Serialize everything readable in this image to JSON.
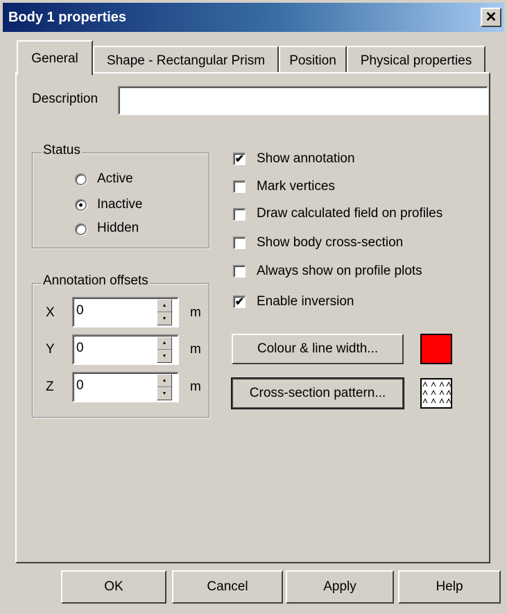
{
  "window": {
    "title": "Body 1 properties",
    "close_glyph": "✕"
  },
  "tabs": [
    {
      "label": "General",
      "active": true
    },
    {
      "label": "Shape - Rectangular Prism",
      "active": false
    },
    {
      "label": "Position",
      "active": false
    },
    {
      "label": "Physical properties",
      "active": false
    }
  ],
  "general": {
    "description_label": "Description",
    "description_value": "",
    "status": {
      "title": "Status",
      "options": [
        {
          "label": "Active",
          "selected": false
        },
        {
          "label": "Inactive",
          "selected": true
        },
        {
          "label": "Hidden",
          "selected": false
        }
      ]
    },
    "offsets": {
      "title": "Annotation offsets",
      "rows": [
        {
          "axis": "X",
          "value": "0",
          "unit": "m"
        },
        {
          "axis": "Y",
          "value": "0",
          "unit": "m"
        },
        {
          "axis": "Z",
          "value": "0",
          "unit": "m"
        }
      ]
    },
    "checkboxes": [
      {
        "label": "Show annotation",
        "checked": true
      },
      {
        "label": "Mark vertices",
        "checked": false
      },
      {
        "label": "Draw calculated field on profiles",
        "checked": false
      },
      {
        "label": "Show body cross-section",
        "checked": false
      },
      {
        "label": "Always show on profile plots",
        "checked": false
      },
      {
        "label": "Enable inversion",
        "checked": true
      }
    ],
    "colour_button": "Colour & line width...",
    "colour_swatch": "#ff0000",
    "pattern_button": "Cross-section pattern..."
  },
  "buttons": {
    "ok": "OK",
    "cancel": "Cancel",
    "apply": "Apply",
    "help": "Help"
  },
  "icons": {
    "check": "✔",
    "spin_up": "▲",
    "spin_down": "▼"
  }
}
